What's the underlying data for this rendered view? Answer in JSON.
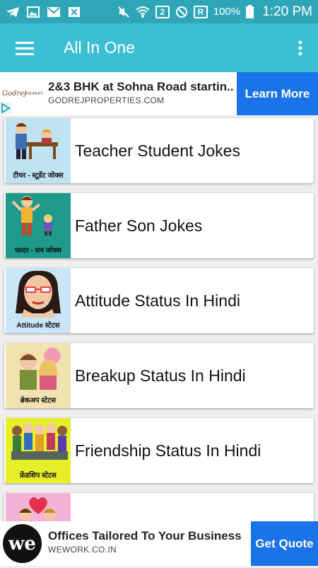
{
  "status_bar": {
    "battery": "100%",
    "time": "1:20 PM",
    "sim_badge": "2",
    "roaming_badge": "R",
    "icons": [
      "telegram-icon",
      "gallery-icon",
      "gmail-icon",
      "close-box-icon",
      "mute-icon",
      "wifi-icon",
      "no-signal-icon",
      "battery-icon"
    ]
  },
  "app_bar": {
    "title": "All In One",
    "bg_color": "#3bbfd3"
  },
  "ad_top": {
    "headline": "2&3 BHK at Sohna Road startin...",
    "url": "GODREJPROPERTIES.COM",
    "cta": "Learn More",
    "logo_text": "Godrej PROPERTIES"
  },
  "items": [
    {
      "title": "Teacher Student Jokes",
      "caption": "टीचर - स्टूडेंट जोक्स",
      "thumb_color": "#bfe3f2"
    },
    {
      "title": "Father Son Jokes",
      "caption": "फादर - सन जोक्स",
      "thumb_color": "#1e9b8a"
    },
    {
      "title": "Attitude Status In Hindi",
      "caption": "Attitude स्टेटस",
      "thumb_color": "#c8e6f8"
    },
    {
      "title": "Breakup Status In Hindi",
      "caption": "ब्रेकअप स्टेटस",
      "thumb_color": "#f1e3b0"
    },
    {
      "title": "Friendship Status In Hindi",
      "caption": "फ्रेंडशिप स्टेटस",
      "thumb_color": "#e7ee2a"
    }
  ],
  "ad_bottom": {
    "headline": "Offices Tailored To Your Business",
    "url": "WEWORK.CO.IN",
    "cta": "Get Quote",
    "logo_text": "we"
  },
  "colors": {
    "status_bar": "#2ea6b7",
    "accent_blue": "#1a73e8"
  }
}
